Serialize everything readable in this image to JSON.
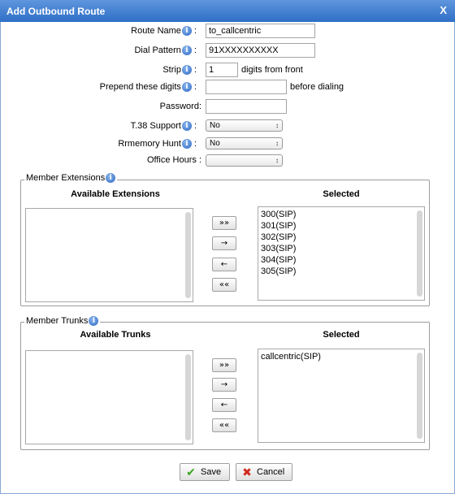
{
  "window": {
    "title": "Add Outbound Route",
    "close_label": "X"
  },
  "form": {
    "route_name": {
      "label": "Route Name",
      "value": "to_callcentric"
    },
    "dial_pattern": {
      "label": "Dial Pattern",
      "value": "91XXXXXXXXXX"
    },
    "strip": {
      "label": "Strip",
      "value": "1",
      "suffix": "digits from front"
    },
    "prepend": {
      "label": "Prepend these digits",
      "value": "",
      "suffix": "before dialing"
    },
    "password": {
      "label": "Password:",
      "value": ""
    },
    "t38": {
      "label": "T.38 Support",
      "value": "No"
    },
    "rrmemory": {
      "label": "Rrmemory Hunt",
      "value": "No"
    },
    "office_hours": {
      "label": "Office Hours :",
      "value": ""
    }
  },
  "extensions": {
    "legend": "Member Extensions",
    "available_header": "Available Extensions",
    "selected_header": "Selected",
    "available": [],
    "selected": [
      "300(SIP)",
      "301(SIP)",
      "302(SIP)",
      "303(SIP)",
      "304(SIP)",
      "305(SIP)"
    ]
  },
  "trunks": {
    "legend": "Member Trunks",
    "available_header": "Available Trunks",
    "selected_header": "Selected",
    "available": [],
    "selected": [
      "callcentric(SIP)"
    ]
  },
  "move_buttons": {
    "add_all": "»»",
    "add": "→",
    "remove": "←",
    "remove_all": "««"
  },
  "actions": {
    "save": "Save",
    "cancel": "Cancel"
  },
  "icons": {
    "info": "i",
    "save": "✔",
    "cancel": "✖"
  }
}
